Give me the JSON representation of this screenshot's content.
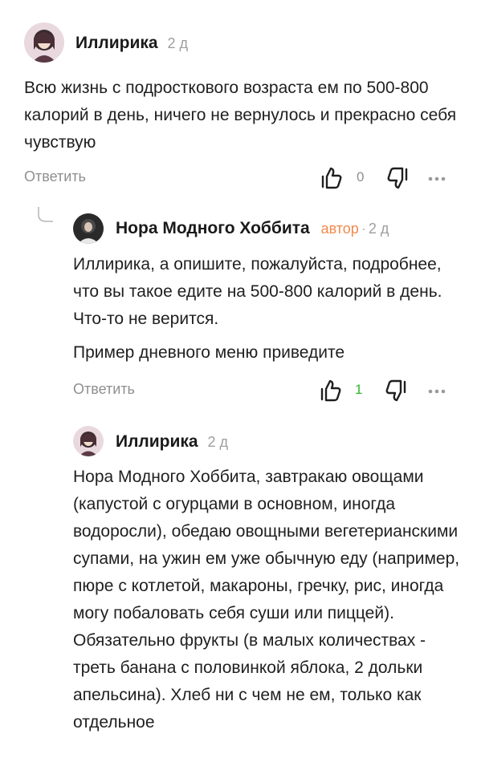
{
  "comments": [
    {
      "author": "Иллирика",
      "time": "2 д",
      "paragraphs": [
        "Всю жизнь с подросткового возраста ем по 500-800 калорий в день, ничего не вернулось и прекрасно себя чувствую"
      ],
      "reply_label": "Ответить",
      "likes": "0",
      "avatar_icon": "anime-girl-avatar"
    },
    {
      "author": "Нора Модного Хоббита",
      "badge": "автор",
      "separator": "·",
      "time": "2 д",
      "paragraphs": [
        "Иллирика, а опишите, пожалуйста, подробнее, что вы такое едите на 500-800 калорий в день. Что-то не верится.",
        "Пример дневного меню приведите"
      ],
      "reply_label": "Ответить",
      "likes": "1",
      "likes_color": "#2eb82e",
      "avatar_icon": "author-avatar"
    },
    {
      "author": "Иллирика",
      "time": "2 д",
      "paragraphs": [
        "Нора Модного Хоббита, завтракаю овощами (капустой с огурцами в основном, иногда водоросли), обедаю овощными вегетерианскими супами, на ужин ем уже обычную еду (например, пюре с котлетой, макароны, гречку, рис, иногда могу побаловать себя суши или пиццей). Обязательно фрукты (в малых количествах - треть банана с половинкой яблока, 2 дольки апельсина). Хлеб ни с чем не ем, только как отдельное"
      ],
      "avatar_icon": "anime-girl-avatar"
    }
  ],
  "colors": {
    "text": "#1f1f1f",
    "muted": "#8f8f8f",
    "author_badge": "#f08a4b",
    "like_active": "#2eb82e"
  }
}
